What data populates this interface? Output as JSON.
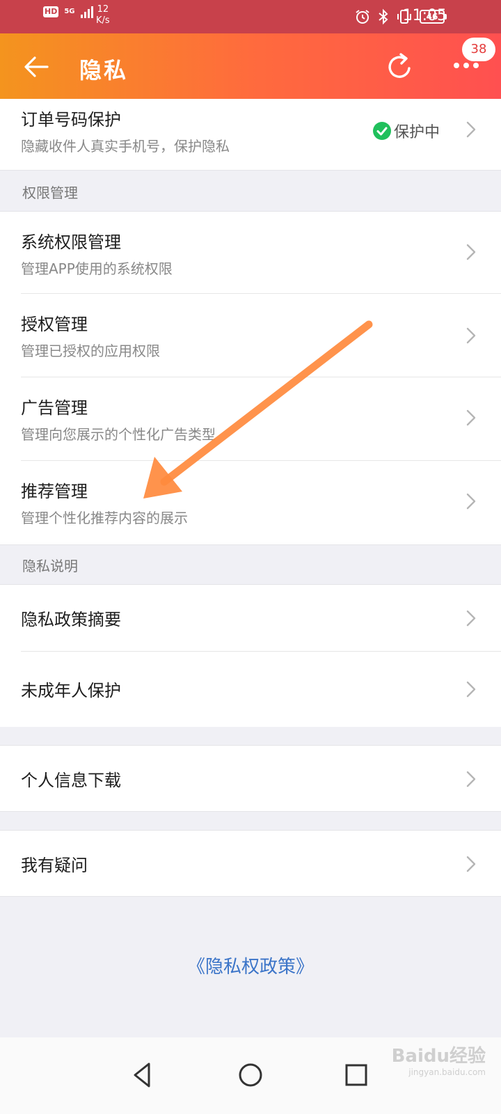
{
  "status_bar": {
    "hd": "HD",
    "network": "5G",
    "speed_value": "12",
    "speed_unit": "K/s",
    "battery": "46",
    "time": "11:05"
  },
  "header": {
    "title": "隐私",
    "badge_count": "38"
  },
  "order_protection": {
    "title": "订单号码保护",
    "subtitle": "隐藏收件人真实手机号，保护隐私",
    "status": "保护中"
  },
  "sections": {
    "permissions": "权限管理",
    "privacy_info": "隐私说明"
  },
  "permission_items": [
    {
      "title": "系统权限管理",
      "subtitle": "管理APP使用的系统权限"
    },
    {
      "title": "授权管理",
      "subtitle": "管理已授权的应用权限"
    },
    {
      "title": "广告管理",
      "subtitle": "管理向您展示的个性化广告类型"
    },
    {
      "title": "推荐管理",
      "subtitle": "管理个性化推荐内容的展示"
    }
  ],
  "privacy_items": [
    {
      "title": "隐私政策摘要"
    },
    {
      "title": "未成年人保护"
    }
  ],
  "download_item": {
    "title": "个人信息下载"
  },
  "question_item": {
    "title": "我有疑问"
  },
  "policy_link": "《隐私权政策》",
  "watermark": {
    "brand": "Baidu经验",
    "url": "jingyan.baidu.com"
  },
  "colors": {
    "status_bar": "#c8414b",
    "header_gradient_start": "#f4941e",
    "header_gradient_end": "#ff5050",
    "link": "#3b74c8",
    "check": "#20c05c",
    "annotation_arrow": "#ff8a3d"
  },
  "icons": {
    "back": "back-arrow-icon",
    "refresh": "refresh-icon",
    "more": "more-dots-icon",
    "chevron": "chevron-right-icon",
    "check": "check-circle-icon",
    "nav_back": "triangle-back-icon",
    "nav_home": "circle-home-icon",
    "nav_recent": "square-recent-icon"
  }
}
